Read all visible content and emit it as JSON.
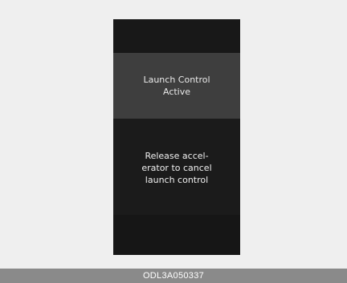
{
  "display": {
    "status_line1": "Launch Control",
    "status_line2": "Active",
    "message_line1": "Release accel-",
    "message_line2": "erator to cancel",
    "message_line3": "launch control"
  },
  "caption": {
    "code": "ODL3A050337"
  },
  "colors": {
    "page_background": "#efefef",
    "display_background": "#1a1a1a",
    "header_panel": "#3e3e3e",
    "caption_bar": "#8a8a8a"
  }
}
